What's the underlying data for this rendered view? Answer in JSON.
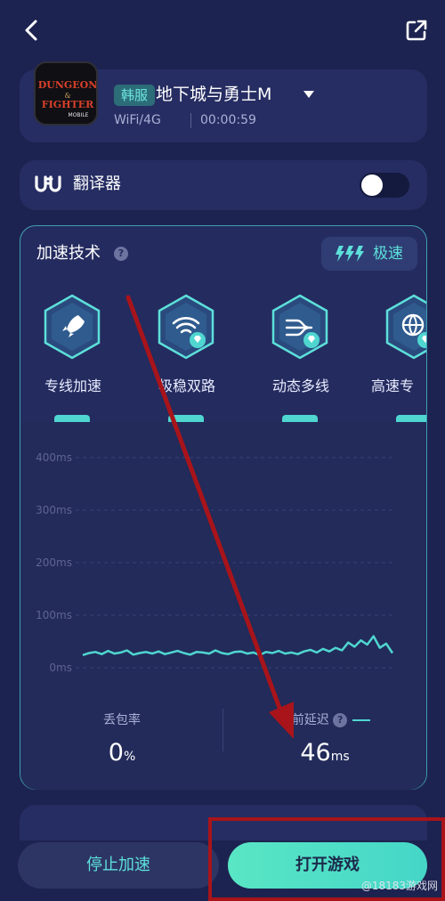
{
  "header": {
    "back_icon": "chevron-left-icon",
    "share_icon": "external-link-icon"
  },
  "game": {
    "logo_text": "DUNGEON & FIGHTER MOBILE",
    "server_badge": "韩服",
    "title": "地下城与勇士M",
    "network": "WiFi/4G",
    "elapsed": "00:00:59"
  },
  "translator": {
    "label": "翻译器",
    "logo_icon": "ufu-logo-icon",
    "enabled": false
  },
  "acceleration": {
    "title": "加速技术",
    "mode_label": "极速",
    "techs": [
      {
        "label": "专线加速",
        "icon": "rocket-icon"
      },
      {
        "label": "极稳双路",
        "icon": "dual-wifi-icon"
      },
      {
        "label": "动态多线",
        "icon": "multi-line-icon"
      },
      {
        "label": "高速专",
        "icon": "globe-icon"
      }
    ]
  },
  "chart_data": {
    "type": "line",
    "title": "",
    "xlabel": "",
    "ylabel": "",
    "y_ticks": [
      "400ms",
      "300ms",
      "200ms",
      "100ms",
      "0ms"
    ],
    "ylim": [
      0,
      400
    ],
    "grid": true,
    "series": [
      {
        "name": "当前延迟",
        "color": "#4fd6d0",
        "values": [
          24,
          28,
          30,
          26,
          32,
          27,
          29,
          33,
          25,
          28,
          30,
          27,
          31,
          26,
          29,
          32,
          28,
          25,
          30,
          29,
          27,
          33,
          28,
          26,
          30,
          31,
          27,
          29,
          24,
          30,
          28,
          32,
          27,
          29,
          26,
          31,
          34,
          29,
          36,
          31,
          38,
          33,
          48,
          40,
          52,
          44,
          60,
          38,
          46,
          28
        ]
      }
    ]
  },
  "stats": {
    "loss_label": "丢包率",
    "loss_value": "0",
    "loss_unit": "%",
    "latency_label": "当前延迟",
    "latency_value": "46",
    "latency_unit": "ms"
  },
  "buttons": {
    "stop": "停止加速",
    "open": "打开游戏"
  },
  "watermark": "@18183游戏网",
  "colors": {
    "accent": "#4fd6d0",
    "background": "#1d2350",
    "annotation_red": "#a8141a"
  }
}
